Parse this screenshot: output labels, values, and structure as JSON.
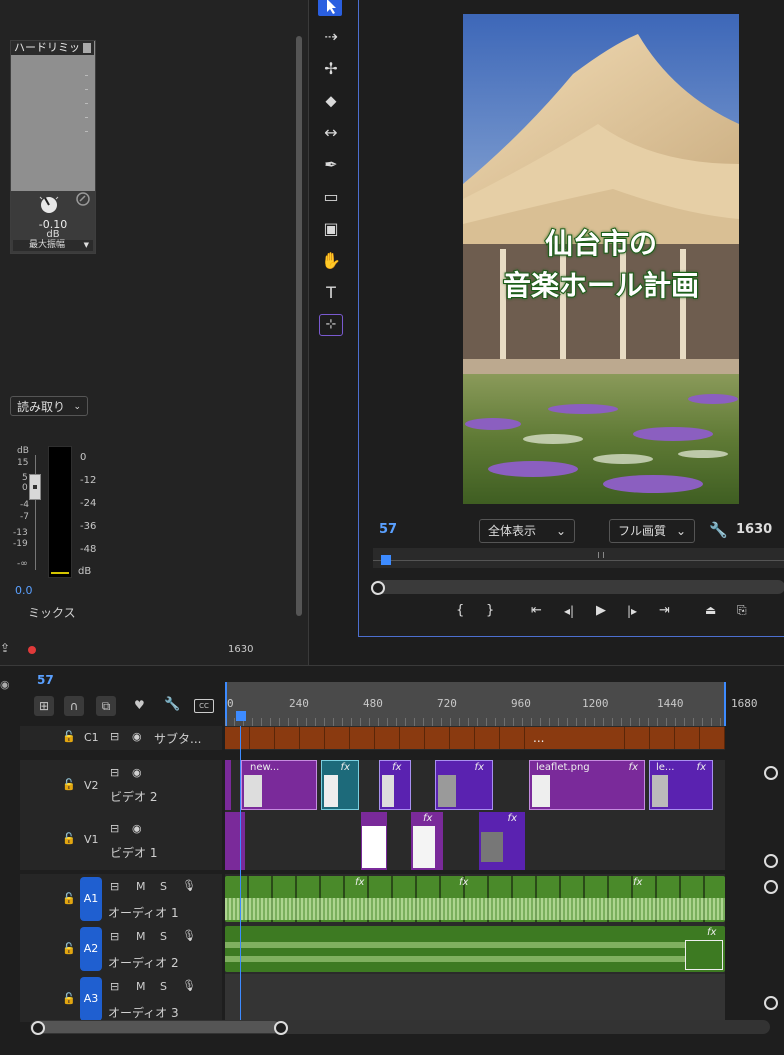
{
  "mixer": {
    "effect_name": "ハードリミッ",
    "knob_value": "-0.10",
    "knob_unit": "dB",
    "knob_param": "最大振幅",
    "automation_mode": "読み取り",
    "scale_left": [
      "dB",
      "15",
      "5",
      "0",
      "-4",
      "-7",
      "-13",
      "-19",
      "-∞"
    ],
    "scale_right": [
      "0",
      "-12",
      "-24",
      "-36",
      "-48",
      "dB"
    ],
    "fader_value": "0.0",
    "track_name": "ミックス",
    "timecode": "1630"
  },
  "program": {
    "title_line1": "仙台市の",
    "title_line2": "音楽ホール計画",
    "current_time": "57",
    "zoom": "全体表示",
    "quality": "フル画質",
    "duration": "1630"
  },
  "timeline": {
    "current_time": "57",
    "ruler": [
      "0",
      "240",
      "480",
      "720",
      "960",
      "1200",
      "1440",
      "1680"
    ],
    "tracks": {
      "c1": {
        "id": "C1",
        "name": "サブタ..."
      },
      "v2": {
        "id": "V2",
        "name": "ビデオ 2"
      },
      "v1": {
        "id": "V1",
        "name": "ビデオ 1"
      },
      "a1": {
        "id": "A1",
        "name": "オーディオ 1"
      },
      "a2": {
        "id": "A2",
        "name": "オーディオ 2"
      },
      "a3": {
        "id": "A3",
        "name": "オーディオ 3"
      }
    },
    "caption_more": "...",
    "clips": {
      "v2_1": "new...",
      "v2_2": "leaflet.png",
      "v2_3": "le..."
    },
    "fx": "fx",
    "m": "M",
    "s": "S"
  },
  "colors": {
    "accent": "#4c6fd0",
    "playhead": "#3d8bff",
    "clip_purple": "#7a2a9a",
    "clip_teal": "#1d6a7a",
    "clip_violet": "#5a22b0",
    "audio_green": "#4a8a2a",
    "caption_orange": "#8a3a10"
  }
}
